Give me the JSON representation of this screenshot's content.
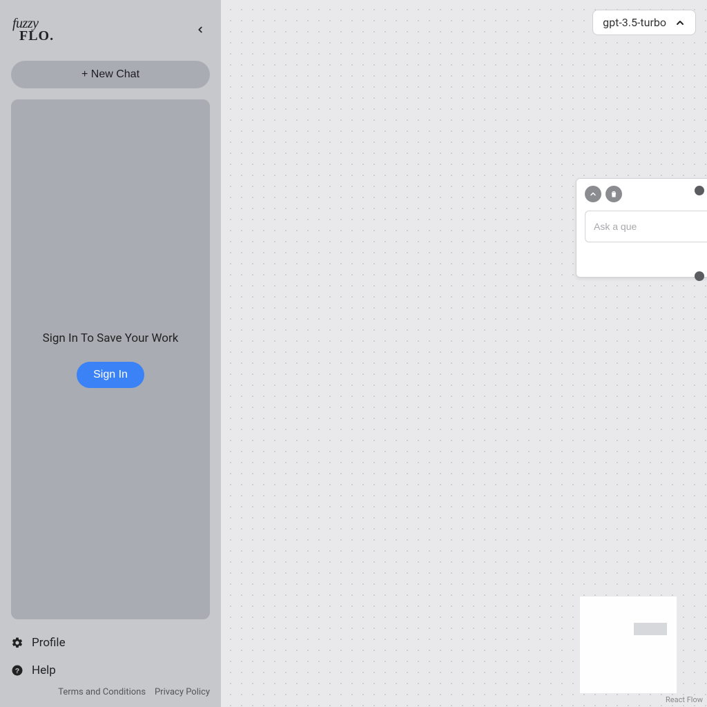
{
  "sidebar": {
    "logo_line1": "fuzzy",
    "logo_line2": "FLO.",
    "new_chat_label": "+ New Chat",
    "panel_message": "Sign In To Save Your Work",
    "signin_label": "Sign In",
    "profile_label": "Profile",
    "help_label": "Help",
    "terms_label": "Terms and Conditions",
    "privacy_label": "Privacy Policy"
  },
  "canvas": {
    "model_selected": "gpt-3.5-turbo",
    "attribution": "React Flow"
  },
  "node": {
    "ask_placeholder": "Ask a que"
  }
}
